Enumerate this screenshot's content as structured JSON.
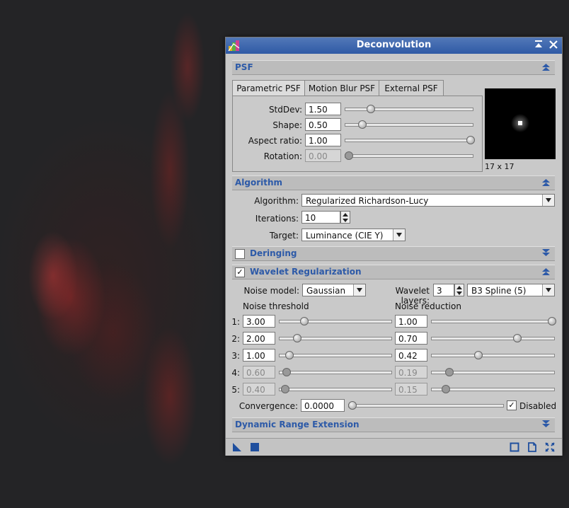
{
  "window": {
    "title": "Deconvolution"
  },
  "psf": {
    "section_label": "PSF",
    "tabs": [
      "Parametric PSF",
      "Motion Blur PSF",
      "External PSF"
    ],
    "active_tab": 0,
    "params": [
      {
        "label": "StdDev:",
        "value": "1.50",
        "level": 0.18,
        "disabled": false
      },
      {
        "label": "Shape:",
        "value": "0.50",
        "level": 0.11,
        "disabled": false
      },
      {
        "label": "Aspect ratio:",
        "value": "1.00",
        "level": 1.0,
        "disabled": false
      },
      {
        "label": "Rotation:",
        "value": "0.00",
        "level": 0.0,
        "disabled": true
      }
    ],
    "preview_size": "17 x 17"
  },
  "algorithm": {
    "section_label": "Algorithm",
    "algorithm_label": "Algorithm:",
    "algorithm_value": "Regularized Richardson-Lucy",
    "iterations_label": "Iterations:",
    "iterations_value": "10",
    "target_label": "Target:",
    "target_value": "Luminance (CIE Y)"
  },
  "deringing": {
    "section_label": "Deringing",
    "checked": false
  },
  "wavelet": {
    "section_label": "Wavelet Regularization",
    "checked": true,
    "noise_model_label": "Noise model:",
    "noise_model_value": "Gaussian",
    "wavelet_layers_label": "Wavelet layers:",
    "wavelet_layers_value": "3",
    "scaling_function": "B3 Spline (5)",
    "noise_threshold_header": "Noise threshold",
    "noise_reduction_header": "Noise reduction",
    "layers": [
      {
        "index": "1:",
        "threshold": "3.00",
        "threshold_level": 0.2,
        "reduction": "1.00",
        "reduction_level": 1.0,
        "disabled": false
      },
      {
        "index": "2:",
        "threshold": "2.00",
        "threshold_level": 0.13,
        "reduction": "0.70",
        "reduction_level": 0.7,
        "disabled": false
      },
      {
        "index": "3:",
        "threshold": "1.00",
        "threshold_level": 0.06,
        "reduction": "0.42",
        "reduction_level": 0.37,
        "disabled": false
      },
      {
        "index": "4:",
        "threshold": "0.60",
        "threshold_level": 0.03,
        "reduction": "0.19",
        "reduction_level": 0.12,
        "disabled": true
      },
      {
        "index": "5:",
        "threshold": "0.40",
        "threshold_level": 0.02,
        "reduction": "0.15",
        "reduction_level": 0.09,
        "disabled": true
      }
    ],
    "convergence_label": "Convergence:",
    "convergence_value": "0.0000",
    "convergence_level": 0.0,
    "disabled_label": "Disabled",
    "disabled_checked": true
  },
  "dynamic_range": {
    "section_label": "Dynamic Range Extension"
  },
  "colors": {
    "accent": "#2d5aa8",
    "titlebar": "#3d67ae"
  }
}
